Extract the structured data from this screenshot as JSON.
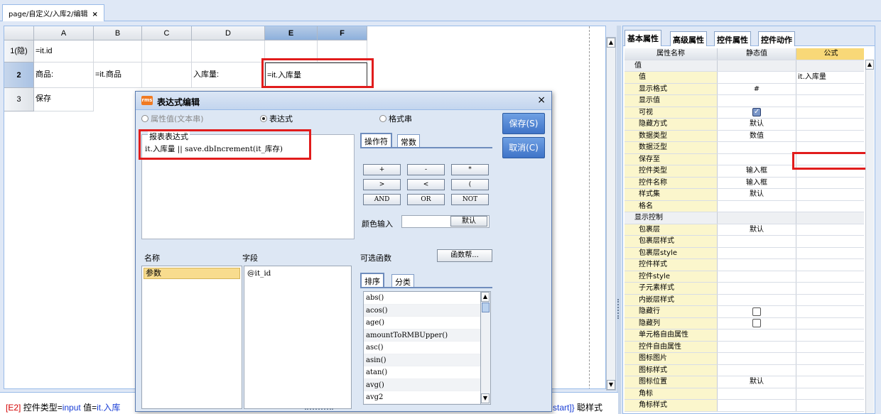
{
  "tab": {
    "label": "page/自定义/入库2/编辑",
    "close": "×"
  },
  "sheet": {
    "columns": [
      "A",
      "B",
      "C",
      "D",
      "E",
      "F"
    ],
    "rows": [
      {
        "header": "1(隐)",
        "cells": [
          "=it.id",
          "",
          "",
          "",
          "",
          ""
        ]
      },
      {
        "header": "2",
        "cells": [
          "商品:",
          "=it.商品",
          "",
          "入库量:",
          "=it.入库量",
          ""
        ]
      },
      {
        "header": "3",
        "cells": [
          "保存",
          "",
          "",
          "",
          "",
          ""
        ]
      }
    ]
  },
  "status": {
    "prefix": "[E2]",
    "text1": " 控件类型=",
    "val1": "input",
    "text2": " 值=",
    "val2": "it.入库",
    "right_blue": "start]}",
    "right_text": " 聪样式"
  },
  "panel": {
    "tabs": [
      "基本属性",
      "高级属性",
      "控件属性",
      "控件动作"
    ],
    "headers": [
      "属性名称",
      "静态值",
      "公式"
    ],
    "rows": [
      {
        "type": "group",
        "name": "值",
        "static": "",
        "formula": ""
      },
      {
        "type": "item",
        "name": "值",
        "static": "",
        "formula": "it.入库量"
      },
      {
        "type": "item",
        "name": "显示格式",
        "static": "#",
        "formula": ""
      },
      {
        "type": "item",
        "name": "显示值",
        "static": "",
        "formula": ""
      },
      {
        "type": "item",
        "name": "可视",
        "static": "",
        "formula": "",
        "check": "on"
      },
      {
        "type": "item",
        "name": "隐藏方式",
        "static": "默认",
        "formula": ""
      },
      {
        "type": "item",
        "name": "数据类型",
        "static": "数值",
        "formula": ""
      },
      {
        "type": "item",
        "name": "数据泛型",
        "static": "",
        "formula": ""
      },
      {
        "type": "item",
        "name": "保存至",
        "static": "",
        "formula": ""
      },
      {
        "type": "item",
        "name": "控件类型",
        "static": "输入框",
        "formula": ""
      },
      {
        "type": "item",
        "name": "控件名称",
        "static": "输入框",
        "formula": ""
      },
      {
        "type": "item",
        "name": "样式集",
        "static": "默认",
        "formula": ""
      },
      {
        "type": "item",
        "name": "格名",
        "static": "",
        "formula": ""
      },
      {
        "type": "group",
        "name": "显示控制",
        "static": "",
        "formula": ""
      },
      {
        "type": "item",
        "name": "包裹层",
        "static": "默认",
        "formula": ""
      },
      {
        "type": "item",
        "name": "包裹层样式",
        "static": "",
        "formula": ""
      },
      {
        "type": "item",
        "name": "包裹层style",
        "static": "",
        "formula": ""
      },
      {
        "type": "item",
        "name": "控件样式",
        "static": "",
        "formula": ""
      },
      {
        "type": "item",
        "name": "控件style",
        "static": "",
        "formula": ""
      },
      {
        "type": "item",
        "name": "子元素样式",
        "static": "",
        "formula": ""
      },
      {
        "type": "item",
        "name": "内嵌层样式",
        "static": "",
        "formula": ""
      },
      {
        "type": "item",
        "name": "隐藏行",
        "static": "",
        "formula": "",
        "check": "off"
      },
      {
        "type": "item",
        "name": "隐藏列",
        "static": "",
        "formula": "",
        "check": "off"
      },
      {
        "type": "item",
        "name": "单元格自由属性",
        "static": "",
        "formula": ""
      },
      {
        "type": "item",
        "name": "控件自由属性",
        "static": "",
        "formula": ""
      },
      {
        "type": "item",
        "name": "图标图片",
        "static": "",
        "formula": ""
      },
      {
        "type": "item",
        "name": "图标样式",
        "static": "",
        "formula": ""
      },
      {
        "type": "item",
        "name": "图标位置",
        "static": "默认",
        "formula": ""
      },
      {
        "type": "item",
        "name": "角标",
        "static": "",
        "formula": ""
      },
      {
        "type": "item",
        "name": "角标样式",
        "static": "",
        "formula": ""
      }
    ]
  },
  "dialog": {
    "title": "表达式编辑",
    "logo": "rms",
    "close": "×",
    "radios": [
      "属性值(文本串)",
      "表达式",
      "格式串"
    ],
    "expr_label": "报表表达式",
    "expr_value": "it.入库量 || save.dbIncrement(it_库存)",
    "save_label": "保存(S)",
    "cancel_label": "取消(C)",
    "op_tabs": [
      "操作符",
      "常数"
    ],
    "operators": [
      "+",
      "-",
      "*",
      ">",
      "<",
      "(",
      "AND",
      "OR",
      "NOT"
    ],
    "color_label": "颜色输入",
    "color_default": "默认",
    "name_header": "名称",
    "field_header": "字段",
    "names": [
      "参数"
    ],
    "fields": [
      "@it_id"
    ],
    "func_label": "可选函数",
    "func_help": "函数帮...",
    "func_tabs": [
      "排序",
      "分类"
    ],
    "functions": [
      "abs()",
      "acos()",
      "age()",
      "amountToRMBUpper()",
      "asc()",
      "asin()",
      "atan()",
      "avg()",
      "avg2"
    ]
  },
  "colors": {
    "accent": "#3f74c8",
    "highlight": "#e11c1c",
    "formula_header": "#f8d878"
  }
}
